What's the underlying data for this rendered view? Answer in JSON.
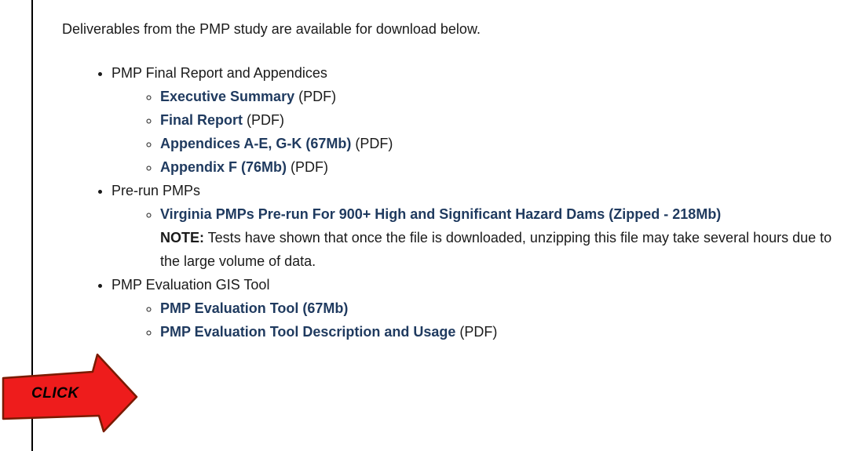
{
  "intro": "Deliverables from the PMP study are available for download below.",
  "sections": [
    {
      "title": "PMP Final Report and Appendices",
      "items": [
        {
          "link": "Executive Summary",
          "suffix": " (PDF)"
        },
        {
          "link": "Final Report",
          "suffix": " (PDF)"
        },
        {
          "link": "Appendices A-E, G-K (67Mb)",
          "suffix": " (PDF)"
        },
        {
          "link": "Appendix F (76Mb)",
          "suffix": " (PDF)"
        }
      ]
    },
    {
      "title": "Pre-run PMPs",
      "items": [
        {
          "link": "Virginia PMPs Pre-run For 900+ High and Significant Hazard Dams (Zipped - 218Mb)",
          "note_label": "NOTE:",
          "note_text": " Tests have shown that once the file is downloaded, unzipping this file may take several hours due to the large volume of data."
        }
      ]
    },
    {
      "title": "PMP Evaluation GIS Tool",
      "items": [
        {
          "link": "PMP Evaluation Tool (67Mb)",
          "suffix": ""
        },
        {
          "link": "PMP Evaluation Tool Description and Usage",
          "suffix": " (PDF)"
        }
      ]
    }
  ],
  "callout": {
    "label": "CLICK",
    "fill_color": "#ee1c1c",
    "stroke_color": "#7a1a00",
    "icon": "red-arrow-right"
  },
  "colors": {
    "link": "#1f3a5f",
    "text": "#1a1a1a"
  }
}
